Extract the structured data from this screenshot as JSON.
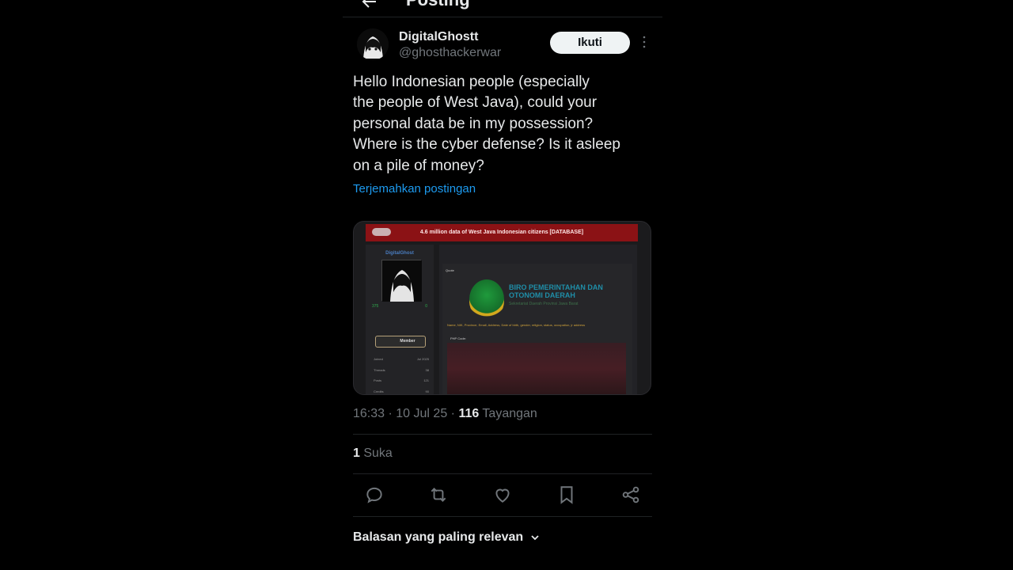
{
  "header": {
    "title": "Posting"
  },
  "author": {
    "name": "DigitalGhostt",
    "handle": "@ghosthackerwar",
    "follow_label": "Ikuti"
  },
  "tweet": {
    "text": "Hello Indonesian people (especially\nthe people of West Java), could your\npersonal data be in my possession?\nWhere is the cyber defense? Is it asleep\non a pile of money?",
    "translate_label": "Terjemahkan postingan"
  },
  "media": {
    "banner_title": "4.6 million data of West Java Indonesian citizens [DATABASE]",
    "username": "DigitalGhost",
    "stats": [
      "375",
      "0"
    ],
    "rank_label": "Member",
    "info": [
      {
        "label": "Joined",
        "value": "Jul 2025"
      },
      {
        "label": "Threads",
        "value": "38"
      },
      {
        "label": "Posts",
        "value": "121"
      },
      {
        "label": "Credits",
        "value": "90"
      }
    ],
    "quote_label": "Quote",
    "org_title": "BIRO PEMERINTAHAN DAN OTONOMI DAERAH",
    "org_sub": "Sekretariat Daerah Provinsi Jawa Barat",
    "fields": "Name, NIK, Province, Email, Address, Date of birth, gender, religion, status, occupation, jr address",
    "code_label": "PHP Code:"
  },
  "meta": {
    "time": "16:33",
    "date": "10 Jul 25",
    "views": "116",
    "views_label": "Tayangan"
  },
  "likes": {
    "count": "1",
    "label": "Suka"
  },
  "actions": [
    "reply-icon",
    "repost-icon",
    "like-icon",
    "bookmark-icon",
    "share-icon"
  ],
  "replies": {
    "sort_label": "Balasan yang paling relevan"
  },
  "colors": {
    "link": "#1d9bf0",
    "muted": "#71767b",
    "text": "#e7e9ea",
    "background": "#000000"
  }
}
